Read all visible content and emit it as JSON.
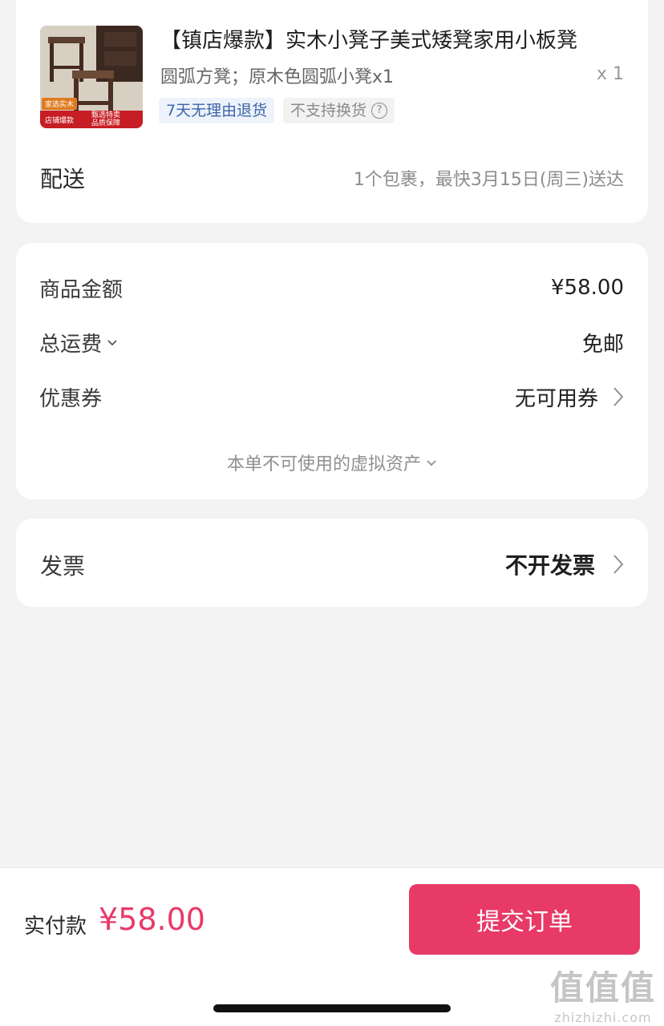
{
  "product": {
    "thumb": {
      "tag_top": "家选实木",
      "tag_bottom_left": "店铺爆款",
      "tag_bottom_right_1": "甄选特卖",
      "tag_bottom_right_2": "品质保障"
    },
    "title": "【镇店爆款】实木小凳子美式矮凳家用小板凳",
    "spec": "圆弧方凳；原木色圆弧小凳x1",
    "qty": "x 1",
    "badges": {
      "return": "7天无理由退货",
      "exchange": "不支持换货",
      "help_icon": "?"
    },
    "delivery": {
      "label": "配送",
      "value": "1个包裹，最快3月15日(周三)送达"
    }
  },
  "price_summary": {
    "goods_amount": {
      "label": "商品金额",
      "value": "¥58.00"
    },
    "shipping": {
      "label": "总运费",
      "value": "免邮"
    },
    "coupon": {
      "label": "优惠券",
      "value": "无可用券"
    },
    "virtual_assets": "本单不可使用的虚拟资产"
  },
  "invoice": {
    "label": "发票",
    "value": "不开发票"
  },
  "bottom_bar": {
    "pay_label": "实付款",
    "pay_amount": "¥58.00",
    "submit_label": "提交订单"
  },
  "watermark": {
    "big": "值值值",
    "small": "zhizhizhi.com"
  },
  "colors": {
    "accent": "#e83a67",
    "background": "#f3f3f4"
  },
  "icons": [
    "chevron-down-icon",
    "chevron-right-icon",
    "question-icon"
  ]
}
